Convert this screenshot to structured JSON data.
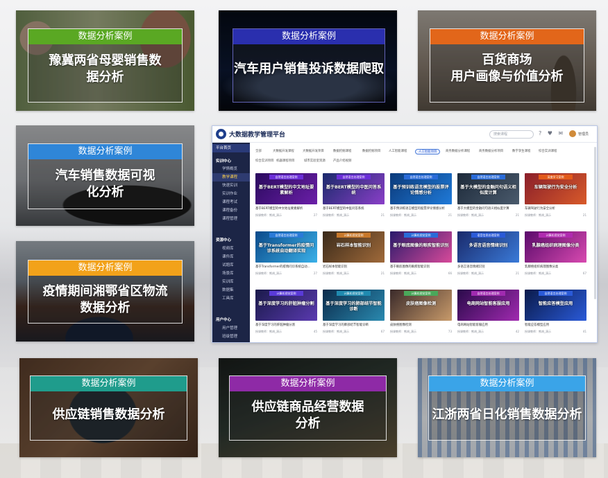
{
  "case_tag": "数据分析案例",
  "cards": [
    {
      "tag": "数据分析案例",
      "title": "豫冀两省母婴销售数据分析",
      "tag_color": "#5aa823"
    },
    {
      "tag": "数据分析案例",
      "title": "汽车用户销售投诉数据爬取",
      "tag_color": "#2a2fae"
    },
    {
      "tag": "数据分析案例",
      "title_line1": "百货商场",
      "title_line2": "用户画像与价值分析",
      "tag_color": "#e2661a"
    },
    {
      "tag": "数据分析案例",
      "title": "汽车销售数据可视化分析",
      "tag_color": "#2f86d8"
    },
    {
      "tag": "数据分析案例",
      "title": "疫情期间湘鄂省区物流数据分析",
      "tag_color": "#f2a21a"
    },
    {
      "tag": "数据分析案例",
      "title": "供应链销售数据分析",
      "tag_color": "#1f9c8c"
    },
    {
      "tag": "数据分析案例",
      "title": "供应链商品经营数据分析",
      "tag_color": "#8e2aa6"
    },
    {
      "tag": "数据分析案例",
      "title": "江浙两省日化销售数据分析",
      "tag_color": "#3aa4e8"
    }
  ],
  "platform": {
    "title": "大数据教学管理平台",
    "search_placeholder": "搜索课程",
    "header_icons": "? ♥ ✉",
    "user": "管理员",
    "sidebar": [
      {
        "label": "平台首页",
        "type": "home"
      },
      {
        "label": "实训中心",
        "type": "group"
      },
      {
        "label": "学情概览",
        "type": "item"
      },
      {
        "label": "教学课程",
        "type": "active"
      },
      {
        "label": "快速实训",
        "type": "item"
      },
      {
        "label": "实训作业",
        "type": "item"
      },
      {
        "label": "课程考试",
        "type": "item"
      },
      {
        "label": "课程备份",
        "type": "item"
      },
      {
        "label": "课程管理",
        "type": "item"
      },
      {
        "label": "资源中心",
        "type": "group"
      },
      {
        "label": "视频库",
        "type": "item"
      },
      {
        "label": "课件库",
        "type": "item"
      },
      {
        "label": "试题库",
        "type": "item"
      },
      {
        "label": "场景库",
        "type": "item"
      },
      {
        "label": "实训库",
        "type": "item"
      },
      {
        "label": "数据集",
        "type": "item"
      },
      {
        "label": "工具库",
        "type": "item"
      },
      {
        "label": "用户中心",
        "type": "group"
      },
      {
        "label": "用户管理",
        "type": "item"
      },
      {
        "label": "班级管理",
        "type": "item"
      }
    ],
    "filters_row1": [
      "全部",
      "大数据开发课程",
      "大数据开发项目",
      "数据挖掘课程",
      "数据挖掘项目",
      "人工智能课程",
      "人工智能项目",
      "商务数据分析课程",
      "商务数据分析项目",
      "数字孪生课程",
      "综合实训课程"
    ],
    "filters_row2": [
      "综合实训项目",
      "机器课程项目",
      "城市实验室资源",
      "产品介绍视频"
    ],
    "selected_filter": "人工智能项目",
    "tiles": [
      {
        "tag": "自然语言处理案例",
        "name": "基于BERT模型的中文地址要素解析",
        "desc": "基于BERT模型的中文地址要素解析",
        "meta": "授课教师：熊胡_演示",
        "count": "27"
      },
      {
        "tag": "自然语言处理案例",
        "name": "基于BERT模型的中医问答系统",
        "desc": "基于BERT模型的中医问答系统",
        "meta": "授课教师：熊胡_演示",
        "count": "21"
      },
      {
        "tag": "自然语言处理案例",
        "name": "基于预训练语言模型的股票评论情感分析",
        "desc": "基于预训练语言模型的股票评论情感分析",
        "meta": "授课教师：熊胡_演示",
        "count": "21"
      },
      {
        "tag": "自然语言处理案例",
        "name": "基于大模型的金融问句语义相似度计算",
        "desc": "基于大模型的金融问句语义相似度计算",
        "meta": "授课教师：熊胡_演示",
        "count": "21"
      },
      {
        "tag": "深度学习案例",
        "name": "车辆驾驶行为安全分析",
        "desc": "车辆驾驶行为安全分析",
        "meta": "授课教师：熊胡_演示",
        "count": "21"
      },
      {
        "tag": "自然语言处理案例",
        "name": "基于Transformer的疫情问诊系统自动翻译实现",
        "desc": "基于Transformer的疫情问诊系统自动...",
        "meta": "授课教师：熊胡_演示",
        "count": "27"
      },
      {
        "tag": "计算机视觉案例",
        "name": "岩石样本智能识别",
        "desc": "岩石样本智能识别",
        "meta": "授课教师：熊胡_演示",
        "count": "21"
      },
      {
        "tag": "计算机视觉案例",
        "name": "基于眼底图像的眼疾智能识别",
        "desc": "基于眼底图像的眼疾智能识别",
        "meta": "授课教师：熊胡_演示",
        "count": "66"
      },
      {
        "tag": "语音信息处理案例",
        "name": "多语言语音情绪识别",
        "desc": "多语言语音情绪识别",
        "meta": "授课教师：熊胡_演示",
        "count": "21"
      },
      {
        "tag": "计算机视觉案例",
        "name": "乳腺癌组织病理图像分类",
        "desc": "乳腺癌组织病理图像分类",
        "meta": "授课教师：熊胡_演示",
        "count": "67"
      },
      {
        "tag": "计算机视觉案例",
        "name": "基于深度学习的肝脏肿瘤分割",
        "desc": "基于深度学习的肝脏肿瘤分割",
        "meta": "授课教师：熊胡_演示",
        "count": "45"
      },
      {
        "tag": "计算机视觉案例",
        "name": "基于深度学习的肺部结节智能诊断",
        "desc": "基于深度学习的肺部结节智能诊断",
        "meta": "授课教师：熊胡_演示",
        "count": "67"
      },
      {
        "tag": "计算机视觉案例",
        "name": "皮肤癌图像检测",
        "desc": "皮肤癌图像检测",
        "meta": "授课教师：熊胡_演示",
        "count": "73"
      },
      {
        "tag": "自然语言处理案例",
        "name": "电商网站智能客服应用",
        "desc": "电商网站智能客服应用",
        "meta": "授课教师：熊胡_演示",
        "count": "42"
      },
      {
        "tag": "自然语言处理案例",
        "name": "智能应答模型应用",
        "desc": "智能应答模型应用",
        "meta": "授课教师：熊胡_演示",
        "count": "41"
      }
    ]
  }
}
